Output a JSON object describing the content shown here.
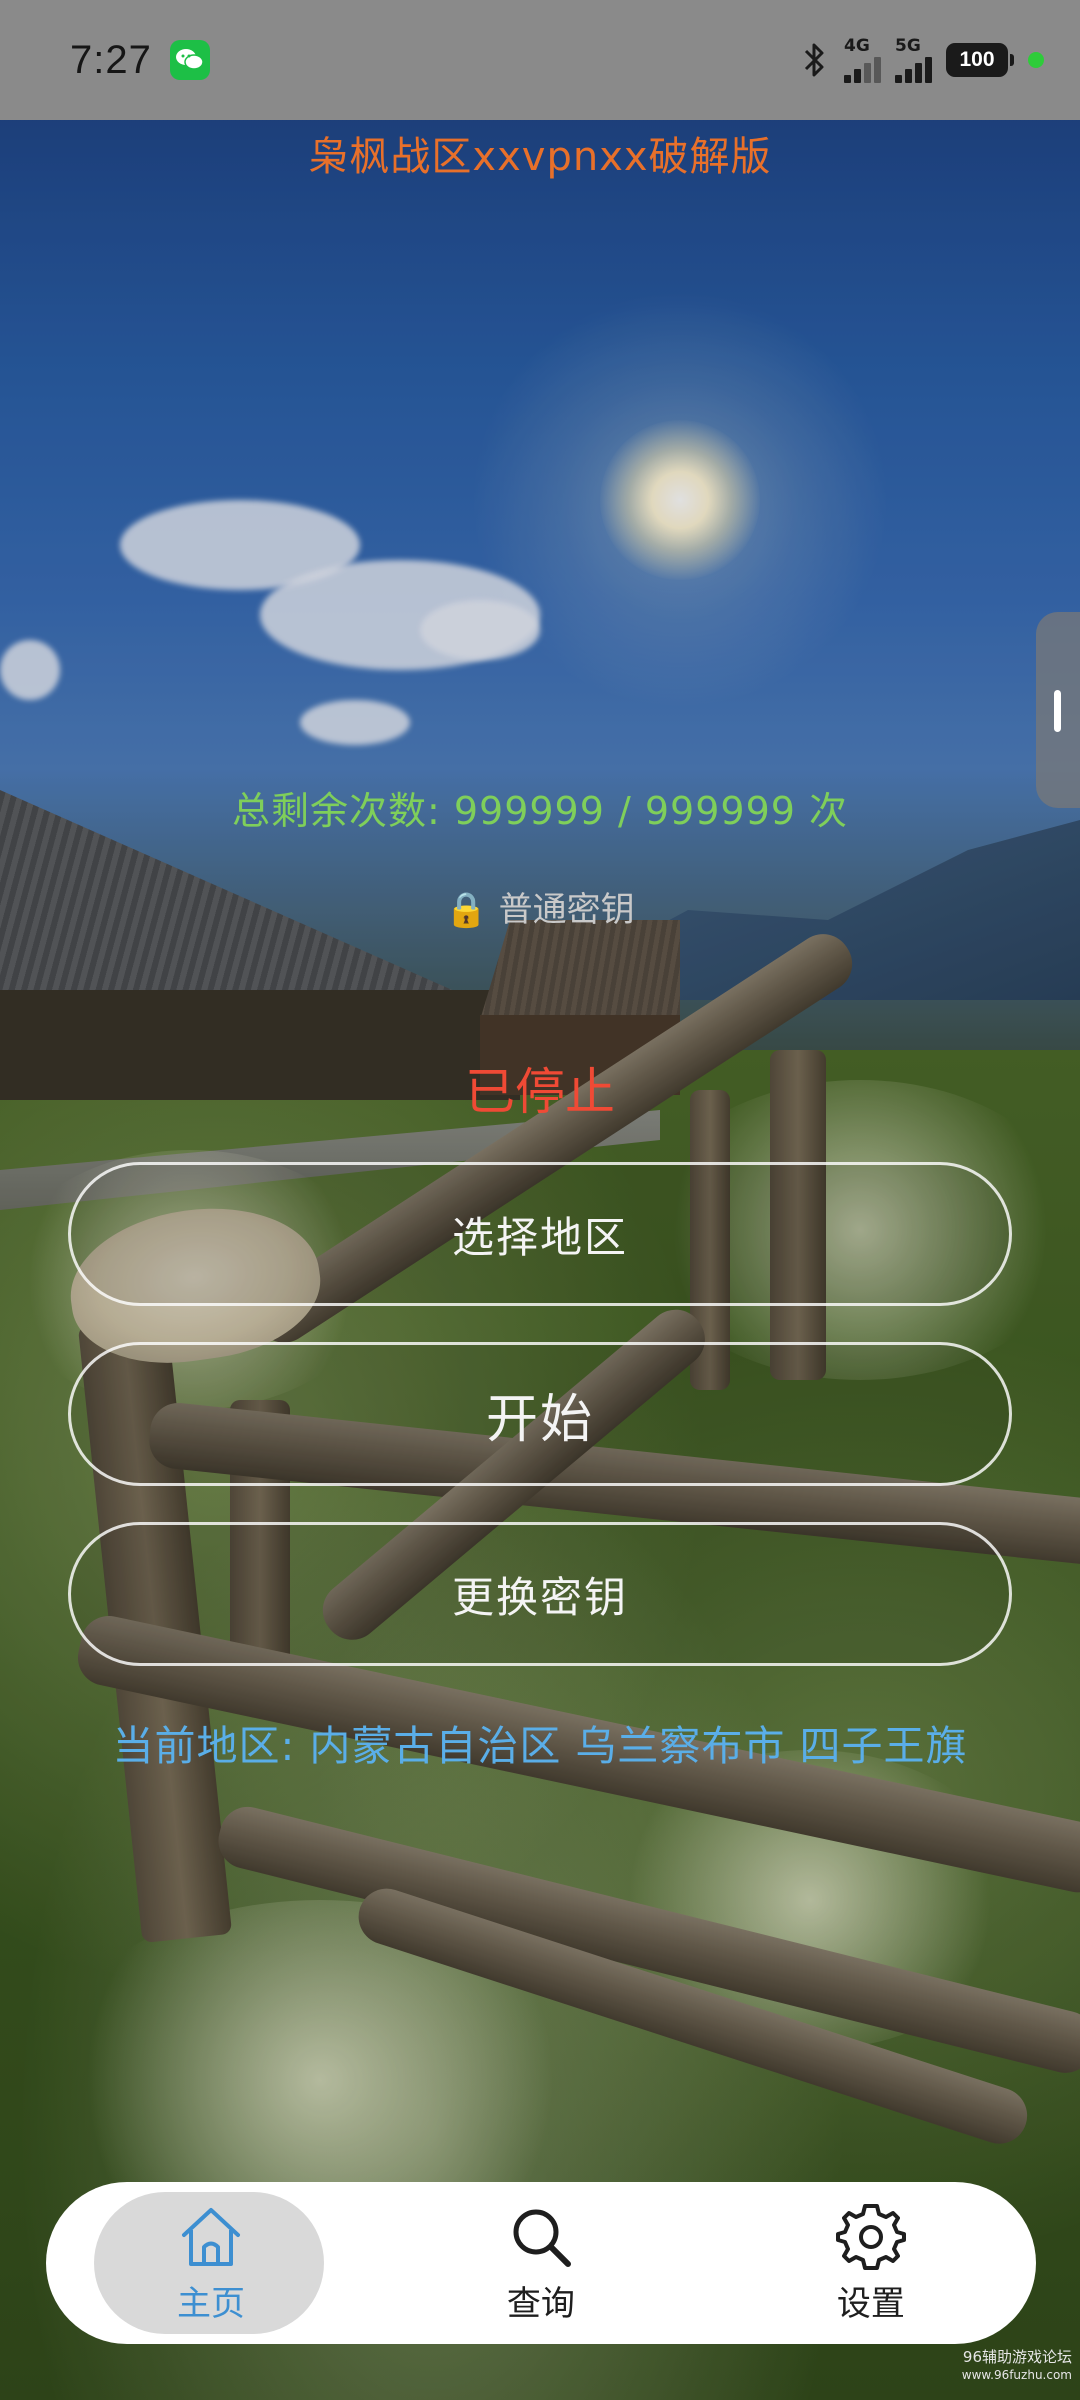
{
  "status_bar": {
    "time": "7:27",
    "net_4g": "4G",
    "net_5g": "5G",
    "battery": "100"
  },
  "app": {
    "title": "枭枫战区xxvpnxx破解版",
    "remaining": "总剩余次数: 999999 / 999999 次",
    "key_type": "🔒 普通密钥",
    "state": "已停止",
    "current_region": "当前地区: 内蒙古自治区 乌兰察布市 四子王旗"
  },
  "buttons": {
    "select_region": "选择地区",
    "start": "开始",
    "change_key": "更换密钥"
  },
  "nav": {
    "items": [
      {
        "label": "主页",
        "icon": "home-icon",
        "active": true
      },
      {
        "label": "查询",
        "icon": "search-icon",
        "active": false
      },
      {
        "label": "设置",
        "icon": "gear-icon",
        "active": false
      }
    ]
  },
  "watermark": {
    "line1": "96辅助游戏论坛",
    "line2": "www.96fuzhu.com"
  },
  "colors": {
    "title": "#e8702a",
    "remaining": "#7fcf5a",
    "state": "#f04a35",
    "region": "#5aaee8",
    "nav_active": "#3d8fd1"
  }
}
